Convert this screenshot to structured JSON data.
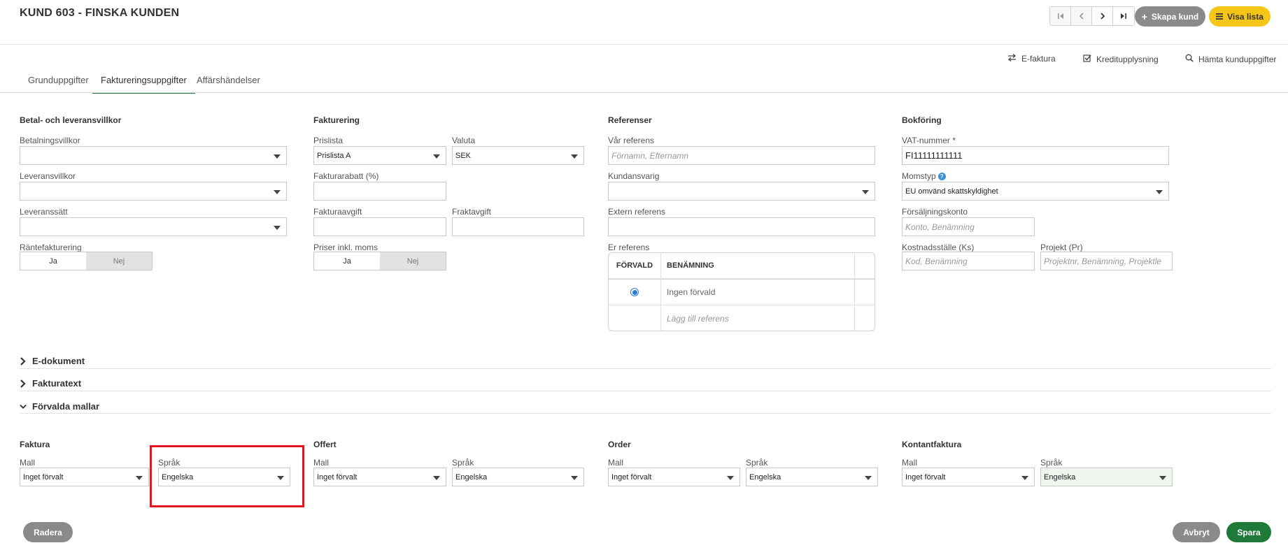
{
  "header": {
    "title": "KUND 603 - FINSKA KUNDEN",
    "create_label": "Skapa kund",
    "list_label": "Visa lista"
  },
  "actions": {
    "efaktura": "E-faktura",
    "credit": "Kreditupplysning",
    "fetch": "Hämta kunduppgifter"
  },
  "tabs": [
    {
      "label": "Grunduppgifter"
    },
    {
      "label": "Faktureringsuppgifter"
    },
    {
      "label": "Affärshändelser"
    }
  ],
  "betal": {
    "title": "Betal- och leveransvillkor",
    "betalningsvillkor_label": "Betalningsvillkor",
    "betalningsvillkor_value": "",
    "leveransvillkor_label": "Leveransvillkor",
    "leveransvillkor_value": "",
    "leveranssatt_label": "Leveranssätt",
    "leveranssatt_value": "",
    "rantefakturering_label": "Räntefakturering",
    "ja": "Ja",
    "nej": "Nej"
  },
  "fakturering": {
    "title": "Fakturering",
    "prislista_label": "Prislista",
    "prislista_value": "Prislista A",
    "valuta_label": "Valuta",
    "valuta_value": "SEK",
    "fakturarabatt_label": "Fakturarabatt (%)",
    "fakturaavgift_label": "Fakturaavgift",
    "fraktavgift_label": "Fraktavgift",
    "priser_label": "Priser inkl. moms",
    "ja": "Ja",
    "nej": "Nej"
  },
  "referenser": {
    "title": "Referenser",
    "var_referens_label": "Vår referens",
    "var_referens_placeholder": "Förnamn, Efternamn",
    "kundansvarig_label": "Kundansvarig",
    "extern_label": "Extern referens",
    "er_referens_label": "Er referens",
    "table_headers": [
      "FÖRVALD",
      "BENÄMNING"
    ],
    "rows": [
      {
        "name": "Ingen förvald"
      },
      {
        "name": "Lägg till referens"
      }
    ]
  },
  "bokforing": {
    "title": "Bokföring",
    "vat_label": "VAT-nummer *",
    "vat_value": "FI11111111111",
    "momstyp_label": "Momstyp",
    "momstyp_value": "EU omvänd skattskyldighet",
    "forsaljningskonto_label": "Försäljningskonto",
    "forsaljningskonto_placeholder": "Konto, Benämning",
    "kostnadsstalle_label": "Kostnadsställe (Ks)",
    "kostnadsstalle_placeholder": "Kod, Benämning",
    "projekt_label": "Projekt (Pr)",
    "projekt_placeholder": "Projektnr, Benämning, Projektle"
  },
  "collapsibles": {
    "edokument": "E-dokument",
    "fakturatext": "Fakturatext",
    "forvalda": "Förvalda mallar"
  },
  "templates": {
    "mall_label": "Mall",
    "sprak_label": "Språk",
    "groups": [
      {
        "title": "Faktura",
        "mall": "Inget förvalt",
        "sprak": "Engelska"
      },
      {
        "title": "Offert",
        "mall": "Inget förvalt",
        "sprak": "Engelska"
      },
      {
        "title": "Order",
        "mall": "Inget förvalt",
        "sprak": "Engelska"
      },
      {
        "title": "Kontantfaktura",
        "mall": "Inget förvalt",
        "sprak": "Engelska"
      }
    ]
  },
  "footer": {
    "delete": "Radera",
    "cancel": "Avbryt",
    "save": "Spara"
  },
  "colors": {
    "accent_green": "#1f7a3a",
    "yellow": "#f5c518",
    "highlight": "#e3151e"
  }
}
